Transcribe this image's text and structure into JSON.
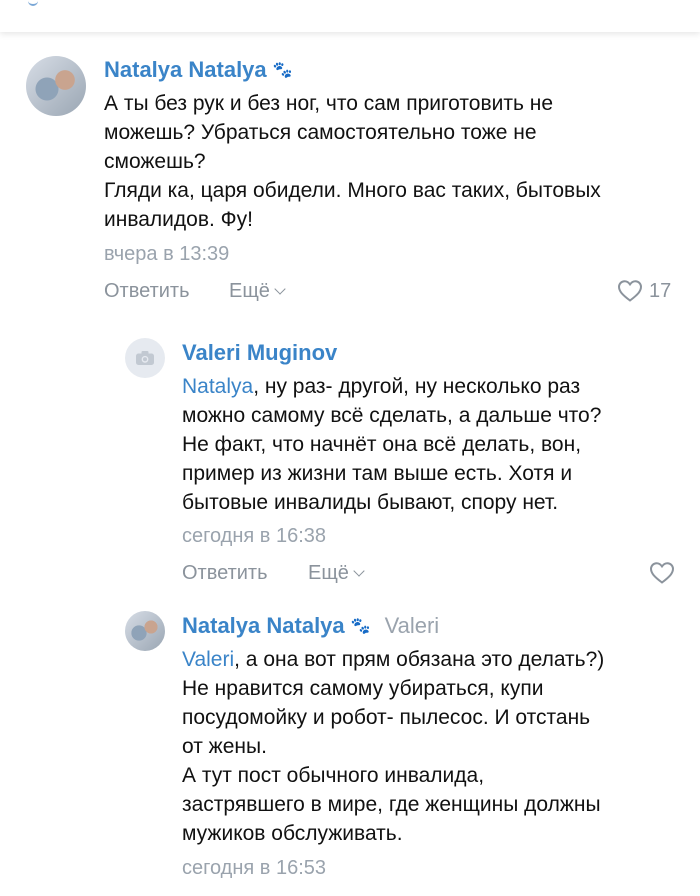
{
  "comments": [
    {
      "author": "Natalya Natalya",
      "lines": [
        "А ты без рук и без ног, что сам приготовить не",
        "можешь? Убраться самостоятельно тоже не",
        "сможешь?",
        "Гляди ка, царя обидели. Много вас таких, бытовых",
        "инвалидов. Фу!"
      ],
      "time": "вчера в 13:39",
      "reply_label": "Ответить",
      "more_label": "Ещё",
      "likes": "17"
    },
    {
      "author": "Valeri Muginov",
      "mention": "Natalya",
      "first_line_rest": ", ну раз- другой, ну несколько раз",
      "lines": [
        "можно самому всё сделать, а дальше что?",
        "Не факт, что начнёт она всё делать, вон,",
        "пример из жизни там выше есть. Хотя и",
        "бытовые инвалиды бывают, спору нет."
      ],
      "time": "сегодня в 16:38",
      "reply_label": "Ответить",
      "more_label": "Ещё"
    },
    {
      "author": "Natalya Natalya",
      "reply_to": "Valeri",
      "mention": "Valeri",
      "first_line_rest": ", а она вот прям обязана это делать?)",
      "lines": [
        "Не нравится самому убираться, купи",
        "посудомойку и робот- пылесос. И отстань",
        "от жены.",
        "А тут пост обычного инвалида,",
        "застрявшего в мире, где женщины должны",
        "мужиков обслуживать."
      ],
      "time": "сегодня в 16:53"
    }
  ],
  "icons": {
    "paw": "paw-icon",
    "heart": "heart-icon",
    "camera": "camera-icon",
    "chevron": "chevron-down-icon"
  },
  "colors": {
    "link": "#3a84c8",
    "meta": "#9aa3ad",
    "text": "#111111"
  }
}
